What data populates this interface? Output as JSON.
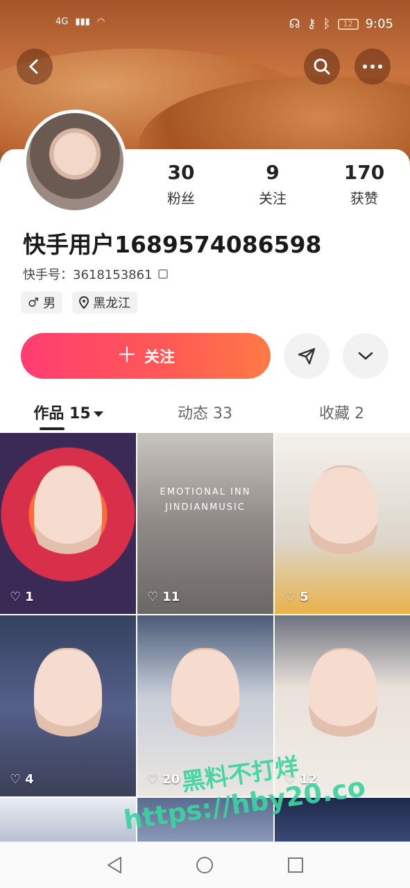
{
  "status_bar": {
    "network": "4G",
    "time": "9:05",
    "battery": "12"
  },
  "header": {
    "back_icon": "back-arrow-icon",
    "search_icon": "search-icon",
    "more_icon": "more-icon"
  },
  "profile": {
    "username": "快手用户1689574086598",
    "id_label": "快手号：3618153861",
    "stats": [
      {
        "value": "30",
        "label": "粉丝"
      },
      {
        "value": "9",
        "label": "关注"
      },
      {
        "value": "170",
        "label": "获赞"
      }
    ],
    "tags": [
      {
        "icon": "male-icon",
        "text": "男"
      },
      {
        "icon": "location-icon",
        "text": "黑龙江"
      }
    ]
  },
  "actions": {
    "follow_label": "关注",
    "follow_color": "#ff4a62"
  },
  "tabs": [
    {
      "label": "作品 15",
      "active": true
    },
    {
      "label": "动态 33",
      "active": false
    },
    {
      "label": "收藏 2",
      "active": false
    }
  ],
  "posts": [
    {
      "likes": "1"
    },
    {
      "likes": "11",
      "overlay_1": "EMOTIONAL INN",
      "overlay_2": "JINDIANMUSIC"
    },
    {
      "likes": "5"
    },
    {
      "likes": "4"
    },
    {
      "likes": "20"
    },
    {
      "likes": "12"
    }
  ],
  "watermark": {
    "line1": "黑料不打烊",
    "line2": "https://hby20.co"
  }
}
